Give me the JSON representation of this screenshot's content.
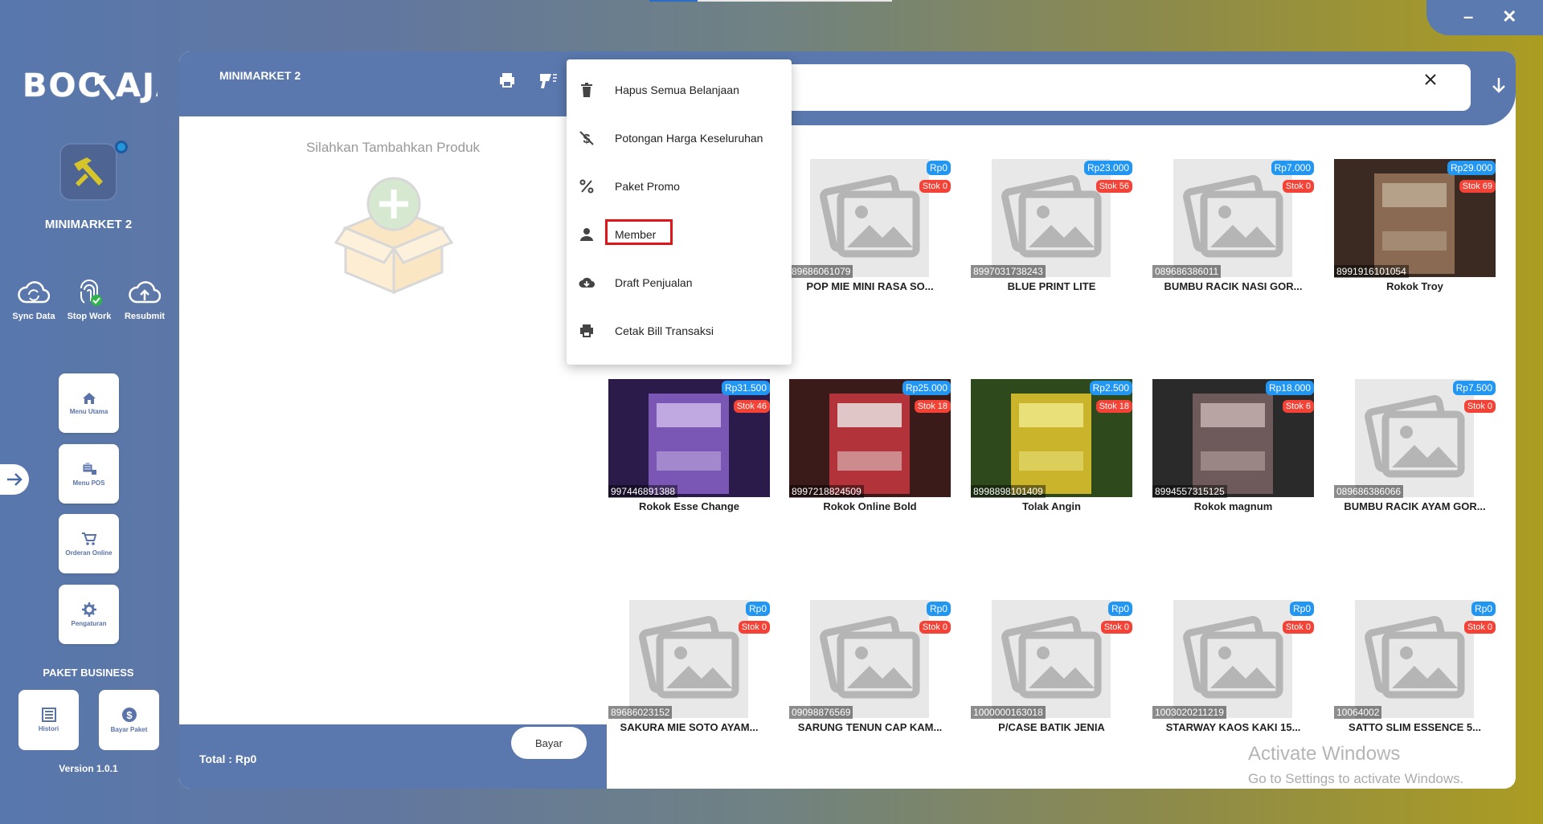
{
  "window": {
    "minimize": "–",
    "close": "✕"
  },
  "brand": {
    "logo_text": "BOC⚒AJA"
  },
  "store": {
    "name": "MINIMARKET 2"
  },
  "quick_actions": [
    {
      "label": "Sync Data",
      "icon": "sync-cloud-icon"
    },
    {
      "label": "Stop Work",
      "icon": "fingerprint-icon"
    },
    {
      "label": "Resubmit",
      "icon": "cloud-upload-icon"
    }
  ],
  "nav": [
    {
      "label": "Menu Utama",
      "icon": "home-icon"
    },
    {
      "label": "Menu POS",
      "icon": "pos-icon"
    },
    {
      "label": "Orderan Online",
      "icon": "cart-icon"
    },
    {
      "label": "Pengaturan",
      "icon": "gear-icon"
    }
  ],
  "package": {
    "title": "PAKET BUSINESS",
    "buttons": [
      {
        "label": "Histori",
        "icon": "list-icon"
      },
      {
        "label": "Bayar Paket",
        "icon": "dollar-icon"
      }
    ]
  },
  "version": "Version 1.0.1",
  "cart": {
    "title": "MINIMARKET 2",
    "empty_text": "Silahkan Tambahkan Produk",
    "total_label": "Total :  Rp0",
    "pay_label": "Bayar"
  },
  "menu": {
    "items": [
      {
        "label": "Hapus Semua Belanjaan",
        "icon": "trash-icon"
      },
      {
        "label": "Potongan Harga Keseluruhan",
        "icon": "no-dollar-icon"
      },
      {
        "label": "Paket Promo",
        "icon": "percent-icon"
      },
      {
        "label": "Member",
        "icon": "person-icon"
      },
      {
        "label": "Draft Penjualan",
        "icon": "cloud-download-icon"
      },
      {
        "label": "Cetak Bill Transaksi",
        "icon": "print-icon"
      }
    ],
    "highlighted": "Member"
  },
  "products": [
    {
      "name": "POP MIE MINI RASA SO...",
      "barcode": "89686061079",
      "price": "Rp0",
      "stock": "Stok 0",
      "image": "placeholder"
    },
    {
      "name": "BLUE PRINT LITE",
      "barcode": "8997031738243",
      "price": "Rp23.000",
      "stock": "Stok 56",
      "image": "placeholder"
    },
    {
      "name": "BUMBU RACIK NASI GOR...",
      "barcode": "089686386011",
      "price": "Rp7.000",
      "stock": "Stok 0",
      "image": "placeholder"
    },
    {
      "name": "Rokok Troy",
      "barcode": "8991916101054",
      "price": "Rp29.000",
      "stock": "Stok 69",
      "image": "photo"
    },
    {
      "name": "Rokok Esse Change",
      "barcode": "997446891388",
      "price": "Rp31.500",
      "stock": "Stok 46",
      "image": "photo"
    },
    {
      "name": "Rokok Online Bold",
      "barcode": "8997218824509",
      "price": "Rp25.000",
      "stock": "Stok 18",
      "image": "photo"
    },
    {
      "name": "Tolak Angin",
      "barcode": "8998898101409",
      "price": "Rp2.500",
      "stock": "Stok 18",
      "image": "photo"
    },
    {
      "name": "Rokok magnum",
      "barcode": "8994557315125",
      "price": "Rp18.000",
      "stock": "Stok 6",
      "image": "photo"
    },
    {
      "name": "BUMBU RACIK AYAM GOR...",
      "barcode": "089686386066",
      "price": "Rp7.500",
      "stock": "Stok 0",
      "image": "placeholder"
    },
    {
      "name": "SAKURA MIE SOTO AYAM...",
      "barcode": "89686023152",
      "price": "Rp0",
      "stock": "Stok 0",
      "image": "placeholder"
    },
    {
      "name": "SARUNG TENUN CAP KAM...",
      "barcode": "09098876569",
      "price": "Rp0",
      "stock": "Stok 0",
      "image": "placeholder"
    },
    {
      "name": "P/CASE BATIK JENIA",
      "barcode": "1000000163018",
      "price": "Rp0",
      "stock": "Stok 0",
      "image": "placeholder"
    },
    {
      "name": "STARWAY KAOS KAKI 15...",
      "barcode": "1003020211219",
      "price": "Rp0",
      "stock": "Stok 0",
      "image": "placeholder"
    },
    {
      "name": "SATTO SLIM ESSENCE 5...",
      "barcode": "10064002",
      "price": "Rp0",
      "stock": "Stok 0",
      "image": "placeholder"
    }
  ],
  "watermark": {
    "line1": "Activate Windows",
    "line2": "Go to Settings to activate Windows."
  }
}
